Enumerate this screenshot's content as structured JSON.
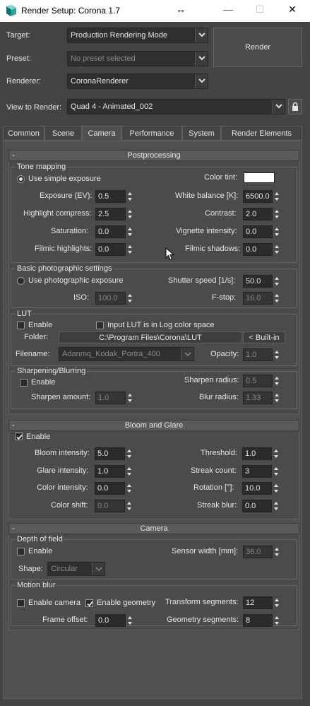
{
  "window": {
    "title": "Render Setup: Corona 1.7",
    "resize_symbol": "↔",
    "min_symbol": "—",
    "max_symbol": "☐",
    "close_symbol": "✕"
  },
  "top": {
    "target_label": "Target:",
    "target_value": "Production Rendering Mode",
    "preset_label": "Preset:",
    "preset_value": "No preset selected",
    "renderer_label": "Renderer:",
    "renderer_value": "CoronaRenderer",
    "view_label": "View to Render:",
    "view_value": "Quad 4 - Animated_002",
    "render_button": "Render"
  },
  "tabs": [
    "Common",
    "Scene",
    "Camera",
    "Performance",
    "System",
    "Render Elements"
  ],
  "active_tab": "Camera",
  "postprocessing": {
    "title": "Postprocessing",
    "minus": "-",
    "tone_mapping": {
      "group_label": "Tone mapping",
      "use_simple_exposure": "Use simple exposure",
      "color_tint": "Color tint:",
      "exposure_label": "Exposure (EV):",
      "exposure": "0.5",
      "white_balance_label": "White balance [K]:",
      "white_balance": "6500.0",
      "highlight_label": "Highlight compress:",
      "highlight": "2.5",
      "contrast_label": "Contrast:",
      "contrast": "2.0",
      "saturation_label": "Saturation:",
      "saturation": "0.0",
      "vignette_label": "Vignette intensity:",
      "vignette": "0.0",
      "filmic_highlights_label": "Filmic highlights:",
      "filmic_highlights": "0.0",
      "filmic_shadows_label": "Filmic shadows:",
      "filmic_shadows": "0.0"
    },
    "photo": {
      "group_label": "Basic photographic settings",
      "use_photo_exposure": "Use photographic exposure",
      "shutter_label": "Shutter speed [1/s]:",
      "shutter": "50.0",
      "iso_label": "ISO:",
      "iso": "100.0",
      "fstop_label": "F-stop:",
      "fstop": "16.0"
    },
    "lut": {
      "group_label": "LUT",
      "enable": "Enable",
      "log_label": "Input LUT is in Log color space",
      "folder_label": "Folder:",
      "folder": "C:\\Program Files\\Corona\\LUT",
      "builtin": "< Built-in",
      "filename_label": "Filename:",
      "filename": "Adanmq_Kodak_Portra_400",
      "opacity_label": "Opacity:",
      "opacity": "1.0"
    },
    "sharpen": {
      "group_label": "Sharpening/Blurring",
      "enable": "Enable",
      "radius_label": "Sharpen radius:",
      "radius": "0.5",
      "amount_label": "Sharpen amount:",
      "amount": "1.0",
      "blur_label": "Blur radius:",
      "blur": "1.33"
    }
  },
  "bloom": {
    "title": "Bloom and Glare",
    "minus": "-",
    "enable": "Enable",
    "bloom_label": "Bloom intensity:",
    "bloom": "5.0",
    "threshold_label": "Threshold:",
    "threshold": "1.0",
    "glare_label": "Glare intensity:",
    "glare": "1.0",
    "streak_count_label": "Streak count:",
    "streak_count": "3",
    "color_int_label": "Color intensity:",
    "color_int": "0.0",
    "rotation_label": "Rotation [°]:",
    "rotation": "10.0",
    "color_shift_label": "Color shift:",
    "color_shift": "0.0",
    "streak_blur_label": "Streak blur:",
    "streak_blur": "0.0"
  },
  "camera": {
    "title": "Camera",
    "minus": "-",
    "dof": {
      "group_label": "Depth of field",
      "enable": "Enable",
      "sensor_label": "Sensor width [mm]:",
      "sensor": "36.0",
      "shape_label": "Shape:",
      "shape": "Circular"
    },
    "motion": {
      "group_label": "Motion blur",
      "enable_camera": "Enable camera",
      "enable_geometry": "Enable geometry",
      "transform_label": "Transform segments:",
      "transform": "12",
      "frame_offset_label": "Frame offset:",
      "frame_offset": "0.0",
      "geometry_label": "Geometry segments:",
      "geometry": "8"
    }
  }
}
